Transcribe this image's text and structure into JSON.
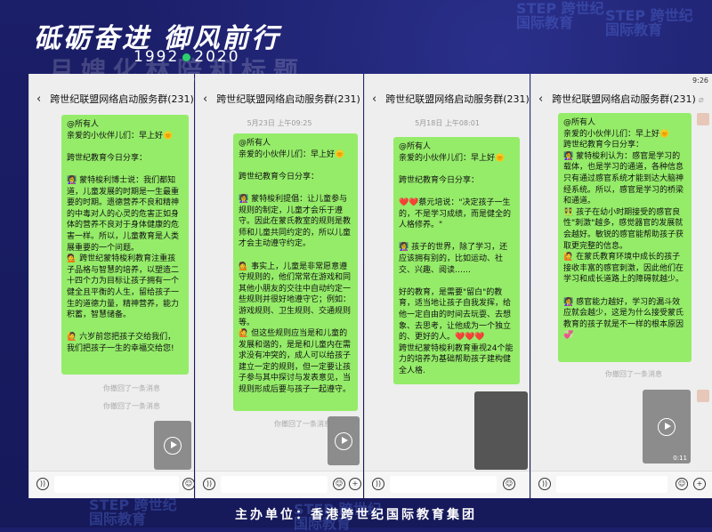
{
  "banner": {
    "slogan": "砥砺奋进 御风前行",
    "years": [
      "1992",
      "2020"
    ],
    "ghost_title": "月嫂化林陪和标题",
    "watermark": "STEP 跨世纪\n国际教育",
    "footer": "主办单位：香港跨世纪国际教育集团"
  },
  "chat": {
    "title": "跨世纪联盟网络启动服务群(231)",
    "recall_text": "你撤回了一条消息",
    "back_icon": "back-arrow-icon",
    "mute_icon": "mute-icon"
  },
  "phones": [
    {
      "status_time": "",
      "message": "@所有人\n亲爱的小伙伴儿们：早上好🌞\n\n跨世纪教育今日分享：\n\n👩‍🏫 蒙特梭利博士说：我们都知道，儿童发展的时期是一生最重要的时期。遗德营养不良和精神的中毒对人的心灵的危害正如身体的营养不良对于身体健康的危害一样。所以，儿童教育是人类展重要的一个问题。\n💁 跨世纪蒙特梭利教育注重孩子品格与智慧的培养，以塑造二十四个力为目标让孩子拥有一个健全且平衡的人生，留给孩子一生的道德力量，精神营养，能力积蓄，智慧储备。\n\n🙋 六岁前您把孩子交给我们，我们把孩子一生的幸福交给您!",
      "recall_count": 2,
      "video_duration": ""
    },
    {
      "stamp": "5月23日 上午09:25",
      "message": "@所有人\n亲爱的小伙伴儿们：早上好🌞\n\n跨世纪教育今日分享：\n\n👩‍🏫 蒙特梭利提倡：让儿童参与规则的制定，儿童才会乐于遵守。因此在蒙氏教室的规则是教师和儿童共同约定的，所以儿童才会主动遵守约定。\n\n💁 事实上，儿童是非常愿意遵守规则的，他们常常在游戏和同其他小朋友的交往中自动约定一些规则并很好地遵守它；例如：游戏规则、卫生规则、交通规则等。\n🙋 但这些规则应当是和儿童的发展和谐的，是是和儿童内在需求没有冲突的，成人可以给孩子建立一定的规则，但一定要让孩子参与其中探讨与发表意见，当规则形成后要与孩子一起遵守。",
      "recall_count": 1,
      "video_duration": ""
    },
    {
      "stamp": "5月18日 上午08:01",
      "message": "@所有人\n亲爱的小伙伴儿们：早上好🌞\n\n跨世纪教育今日分享：\n\n❤️❤️蔡元培说：\"决定孩子一生的，不是学习成绩，而是健全的人格修养。\"\n\n👩‍🏫 孩子的世界，除了学习，还应该拥有别的，比如运动、社交、兴趣、阅读……\n\n好的教育，是需要\"留白\"的教育，适当地让孩子自我发挥，给他一定自由的时间去玩耍、去想象、去思考，让他成为一个独立的、更好的人。❤️❤️❤️\n跨世纪蒙特梭利教育重视24个能力的培养为基础帮助孩子建构健全人格."
    },
    {
      "status_time": "9:26",
      "message": "@所有人\n亲爱的小伙伴儿们：早上好🌞\n跨世纪教育今日分享：\n👩‍🏫 蒙特梭利认为：感官是学习的载体，也是学习的通道，各种信息只有通过感官系统才能到达大脑神经系统。所以，感官是学习的桥梁和通道。\n👯 孩子在幼小时期接受的感官良性\"刺激\"越多，感觉器官的发展就会越好。敏锐的感官能帮助孩子获取更完整的信息。\n🙋 在蒙氏教育环境中成长的孩子接收丰富的感官刺激，因此他们在学习和成长道路上的障碍就越少。\n\n👩‍🏫 感官能力越好，学习的漏斗效应就会越少，这是为什么接受蒙氏教育的孩子就是不一样的根本原因💞",
      "recall_count": 1,
      "video_duration": "0:11"
    }
  ]
}
